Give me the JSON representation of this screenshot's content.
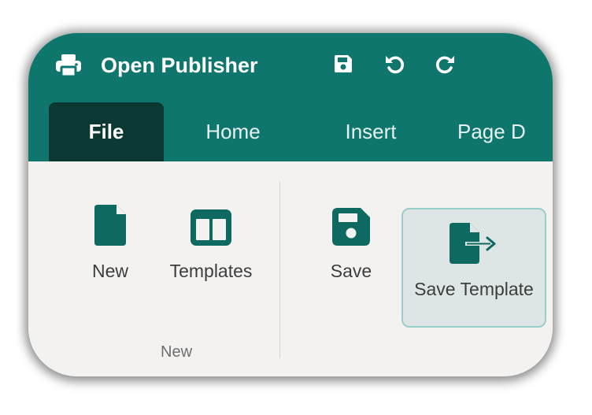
{
  "app": {
    "title": "Open Publisher"
  },
  "tabs": [
    {
      "label": "File",
      "active": true
    },
    {
      "label": "Home",
      "active": false
    },
    {
      "label": "Insert",
      "active": false
    },
    {
      "label": "Page D",
      "active": false
    }
  ],
  "ribbon": {
    "buttons": [
      {
        "label": "New",
        "icon": "file-icon"
      },
      {
        "label": "Templates",
        "icon": "templates-icon"
      },
      {
        "label": "Save",
        "icon": "save-icon"
      },
      {
        "label": "Save Template",
        "icon": "file-export-icon",
        "selected": true
      }
    ],
    "groups": [
      {
        "label": "New"
      }
    ]
  },
  "colors": {
    "header": "#0e766c",
    "active_tab": "#0b3833",
    "ribbon_bg": "#f3f2f1",
    "icon": "#0e6a61"
  }
}
